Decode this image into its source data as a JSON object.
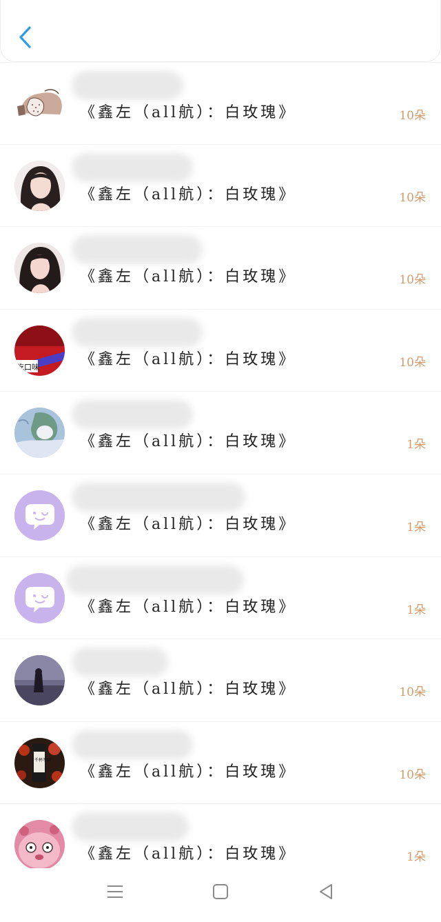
{
  "header": {
    "back_icon": "chevron-left-icon",
    "accent_color": "#2f9be3"
  },
  "items": [
    {
      "title": "《鑫左（all航）：白玫瑰》",
      "count": "10朵",
      "avatar": "meme-avatar",
      "avatar_caption": "差不多是条咸鱼"
    },
    {
      "title": "《鑫左（all航）：白玫瑰》",
      "count": "10朵",
      "avatar": "girl-photo-avatar"
    },
    {
      "title": "《鑫左（all航）：白玫瑰》",
      "count": "10朵",
      "avatar": "girl-photo-avatar"
    },
    {
      "title": "《鑫左（all航）：白玫瑰》",
      "count": "10朵",
      "avatar": "red-photo-avatar",
      "avatar_caption": "吃口味"
    },
    {
      "title": "《鑫左（all航）：白玫瑰》",
      "count": "1朵",
      "avatar": "anime-avatar"
    },
    {
      "title": "《鑫左（all航）：白玫瑰》",
      "count": "1朵",
      "avatar": "default-chat-avatar"
    },
    {
      "title": "《鑫左（all航）：白玫瑰》",
      "count": "1朵",
      "avatar": "default-chat-avatar"
    },
    {
      "title": "《鑫左（all航）：白玫瑰》",
      "count": "10朵",
      "avatar": "dusk-photo-avatar"
    },
    {
      "title": "《鑫左（all航）：白玫瑰》",
      "count": "10朵",
      "avatar": "drink-photo-avatar",
      "avatar_caption": "千杯不醉"
    },
    {
      "title": "《鑫左（all航）：白玫瑰》",
      "count": "1朵",
      "avatar": "pink-toy-avatar"
    }
  ],
  "navbar": {
    "items": [
      "menu-icon",
      "home-square-icon",
      "back-triangle-icon"
    ]
  },
  "colors": {
    "count": "#d49a6a",
    "title": "#222222",
    "default_avatar": "#c9b3ec"
  }
}
